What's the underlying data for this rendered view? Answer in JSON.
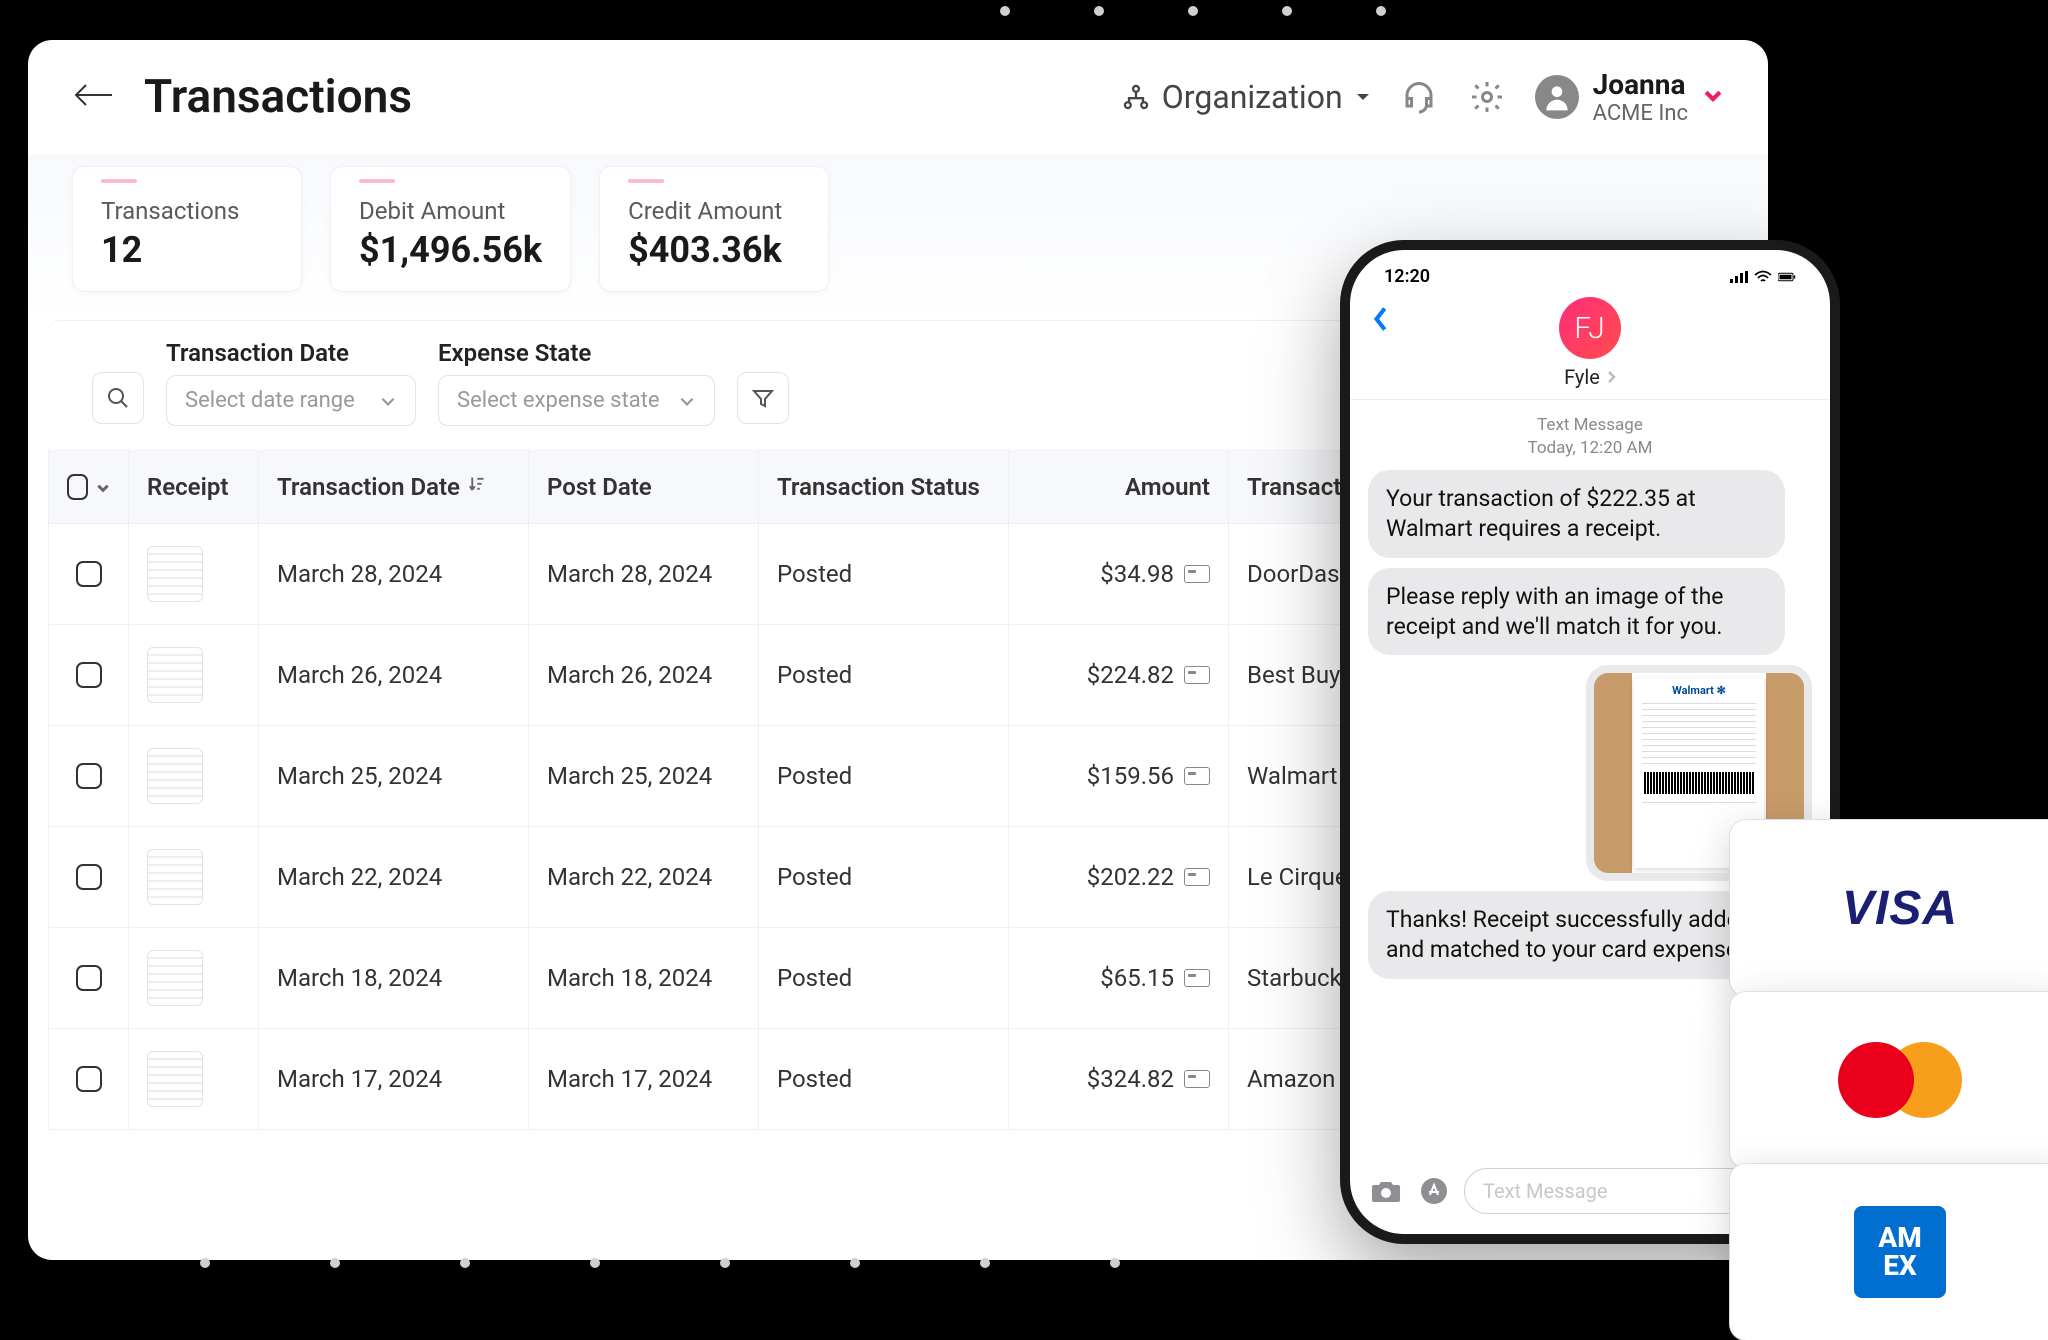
{
  "header": {
    "title": "Transactions",
    "org_selector_label": "Organization",
    "user": {
      "name": "Joanna",
      "org": "ACME Inc"
    }
  },
  "summary": {
    "transactions": {
      "label": "Transactions",
      "value": "12"
    },
    "debit": {
      "label": "Debit Amount",
      "value": "$1,496.56k"
    },
    "credit": {
      "label": "Credit Amount",
      "value": "$403.36k"
    }
  },
  "filters": {
    "date": {
      "label": "Transaction Date",
      "placeholder": "Select date range"
    },
    "state": {
      "label": "Expense State",
      "placeholder": "Select expense state"
    }
  },
  "table": {
    "columns": {
      "receipt": "Receipt",
      "tx_date": "Transaction Date",
      "post_date": "Post Date",
      "status": "Transaction Status",
      "amount": "Amount",
      "transaction": "Transaction"
    },
    "rows": [
      {
        "tx_date": "March 28, 2024",
        "post_date": "March 28, 2024",
        "status": "Posted",
        "amount": "$34.98",
        "merchant": "DoorDash"
      },
      {
        "tx_date": "March 26, 2024",
        "post_date": "March 26, 2024",
        "status": "Posted",
        "amount": "$224.82",
        "merchant": "Best Buy"
      },
      {
        "tx_date": "March 25, 2024",
        "post_date": "March 25, 2024",
        "status": "Posted",
        "amount": "$159.56",
        "merchant": "Walmart"
      },
      {
        "tx_date": "March 22, 2024",
        "post_date": "March 22, 2024",
        "status": "Posted",
        "amount": "$202.22",
        "merchant": "Le Cirque"
      },
      {
        "tx_date": "March 18, 2024",
        "post_date": "March 18, 2024",
        "status": "Posted",
        "amount": "$65.15",
        "merchant": "Starbucks"
      },
      {
        "tx_date": "March 17, 2024",
        "post_date": "March 17, 2024",
        "status": "Posted",
        "amount": "$324.82",
        "merchant": "Amazon"
      }
    ]
  },
  "phone": {
    "time": "12:20",
    "contact": "Fyle",
    "avatar_text": "FJ",
    "meta_line1": "Text Message",
    "meta_line2": "Today, 12:20 AM",
    "msg1": "Your transaction of $222.35 at Walmart requires a receipt.",
    "msg2": "Please reply with an image of the receipt and we'll match it for you.",
    "receipt_brand": "Walmart ✻",
    "msg3": "Thanks! Receipt successfully added and matched to your card expense.",
    "input_placeholder": "Text Message"
  },
  "cards": {
    "visa": "VISA",
    "amex": "AM\nEX"
  }
}
